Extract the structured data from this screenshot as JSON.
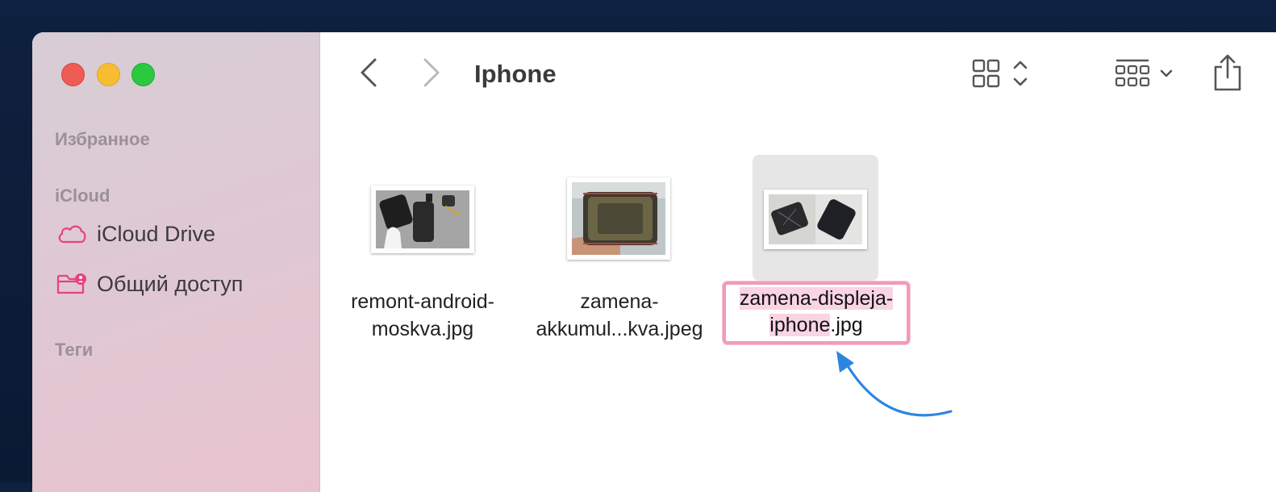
{
  "window": {
    "title": "Iphone"
  },
  "sidebar": {
    "favorites_title": "Избранное",
    "icloud_title": "iCloud",
    "items": [
      {
        "label": "iCloud Drive",
        "icon": "cloud-icon"
      },
      {
        "label": "Общий доступ",
        "icon": "shared-folder-icon"
      }
    ],
    "tags_title": "Теги"
  },
  "toolbar": {
    "back_icon": "chevron-left-icon",
    "forward_icon": "chevron-right-icon",
    "view_icon": "icon-grid-view-icon",
    "group_icon": "group-by-icon",
    "share_icon": "share-icon"
  },
  "files": [
    {
      "line1": "remont-android-",
      "line2": "moskva.jpg"
    },
    {
      "line1": "zamena-",
      "line2": "akkumul...kva.jpeg"
    },
    {
      "line1_selected": "zamena-displeja-",
      "line2_selected": "iphone",
      "line2_rest": ".jpg",
      "renaming": true
    }
  ],
  "colors": {
    "accent_pink": "#e8417f",
    "rename_border": "#f29ab8",
    "arrow": "#2c86e0"
  }
}
